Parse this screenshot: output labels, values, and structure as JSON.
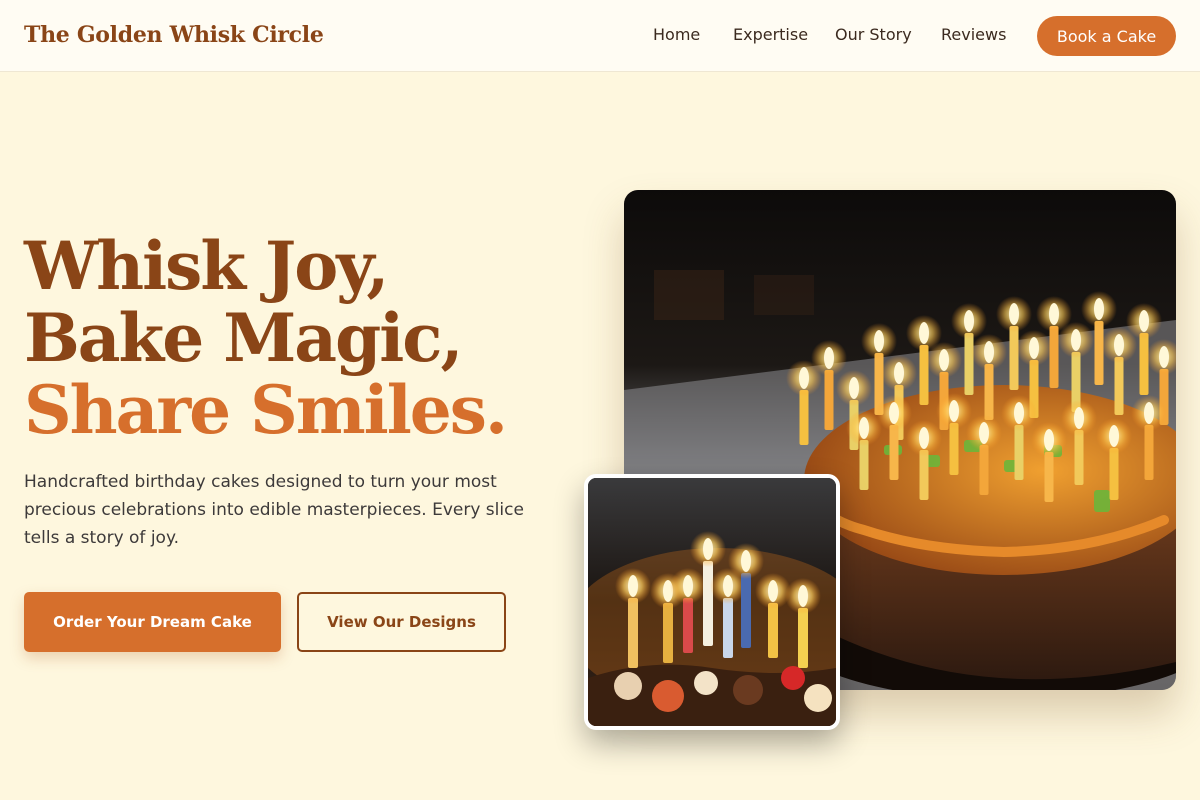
{
  "navbar": {
    "brand": "The Golden Whisk Circle",
    "links": [
      {
        "label": "Home"
      },
      {
        "label": "Expertise"
      },
      {
        "label": "Our Story"
      },
      {
        "label": "Reviews"
      }
    ],
    "cta_label": "Book a Cake"
  },
  "hero": {
    "headline_part1": "Whisk Joy, Bake Magic, ",
    "headline_accent": "Share Smiles.",
    "description": "Handcrafted birthday cakes designed to turn your most precious celebrations into edible masterpieces. Every slice tells a story of joy.",
    "primary_button": "Order Your Dream Cake",
    "secondary_button": "View Our Designs"
  },
  "colors": {
    "brand_brown": "#8a4517",
    "accent_orange": "#d66f2c",
    "page_background": "#fef7de"
  },
  "images": {
    "main": "birthday-cake-with-lit-candles-photo",
    "inset": "close-up-lit-birthday-candles-photo"
  }
}
